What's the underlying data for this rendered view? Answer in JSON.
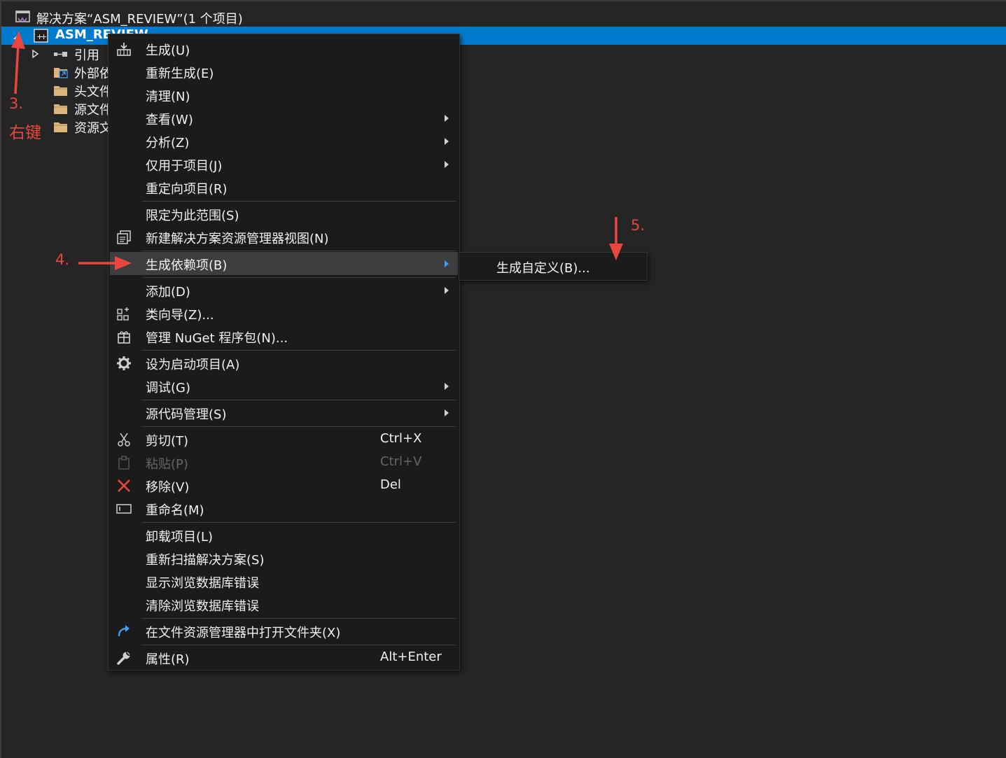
{
  "solution_explorer": {
    "solution_label": "解决方案“ASM_REVIEW”(1 个项目)",
    "project_label": "ASM_REVIEW",
    "children": [
      {
        "label": "引用",
        "icon": "references-icon"
      },
      {
        "label": "外部依赖项",
        "icon": "external-dependencies-folder-icon"
      },
      {
        "label": "头文件",
        "icon": "folder-icon"
      },
      {
        "label": "源文件",
        "icon": "folder-icon"
      },
      {
        "label": "资源文件",
        "icon": "folder-icon"
      }
    ]
  },
  "context_menu": {
    "items": [
      {
        "label": "生成(U)",
        "icon": "build-icon"
      },
      {
        "label": "重新生成(E)"
      },
      {
        "label": "清理(N)"
      },
      {
        "label": "查看(W)",
        "submenu": true
      },
      {
        "label": "分析(Z)",
        "submenu": true
      },
      {
        "label": "仅用于项目(J)",
        "submenu": true
      },
      {
        "label": "重定向项目(R)"
      },
      {
        "label": "限定为此范围(S)"
      },
      {
        "label": "新建解决方案资源管理器视图(N)",
        "icon": "new-view-icon"
      },
      {
        "label": "生成依赖项(B)",
        "submenu": true,
        "highlighted": true
      },
      {
        "label": "添加(D)",
        "submenu": true
      },
      {
        "label": "类向导(Z)...",
        "icon": "class-wizard-icon"
      },
      {
        "label": "管理 NuGet 程序包(N)...",
        "icon": "nuget-icon"
      },
      {
        "label": "设为启动项目(A)",
        "icon": "gear-icon"
      },
      {
        "label": "调试(G)",
        "submenu": true
      },
      {
        "label": "源代码管理(S)",
        "submenu": true
      },
      {
        "label": "剪切(T)",
        "shortcut": "Ctrl+X",
        "icon": "cut-icon"
      },
      {
        "label": "粘贴(P)",
        "shortcut": "Ctrl+V",
        "icon": "paste-icon",
        "disabled": true
      },
      {
        "label": "移除(V)",
        "shortcut": "Del",
        "icon": "remove-icon"
      },
      {
        "label": "重命名(M)",
        "icon": "rename-icon"
      },
      {
        "label": "卸载项目(L)"
      },
      {
        "label": "重新扫描解决方案(S)"
      },
      {
        "label": "显示浏览数据库错误"
      },
      {
        "label": "清除浏览数据库错误"
      },
      {
        "label": "在文件资源管理器中打开文件夹(X)",
        "icon": "open-folder-arrow-icon"
      },
      {
        "label": "属性(R)",
        "shortcut": "Alt+Enter",
        "icon": "wrench-icon"
      }
    ]
  },
  "submenu": {
    "items": [
      {
        "label": "生成自定义(B)..."
      }
    ]
  },
  "annotations": {
    "step3_number": "3.",
    "step3_text": "右键",
    "step4_number": "4.",
    "step5_number": "5."
  },
  "colors": {
    "selection": "#007acc",
    "menu_background": "#1b1b1c",
    "menu_hover": "#3e3e40",
    "annotation_red": "#e8473f",
    "submenu_arrow_active": "#3f9ff6"
  }
}
